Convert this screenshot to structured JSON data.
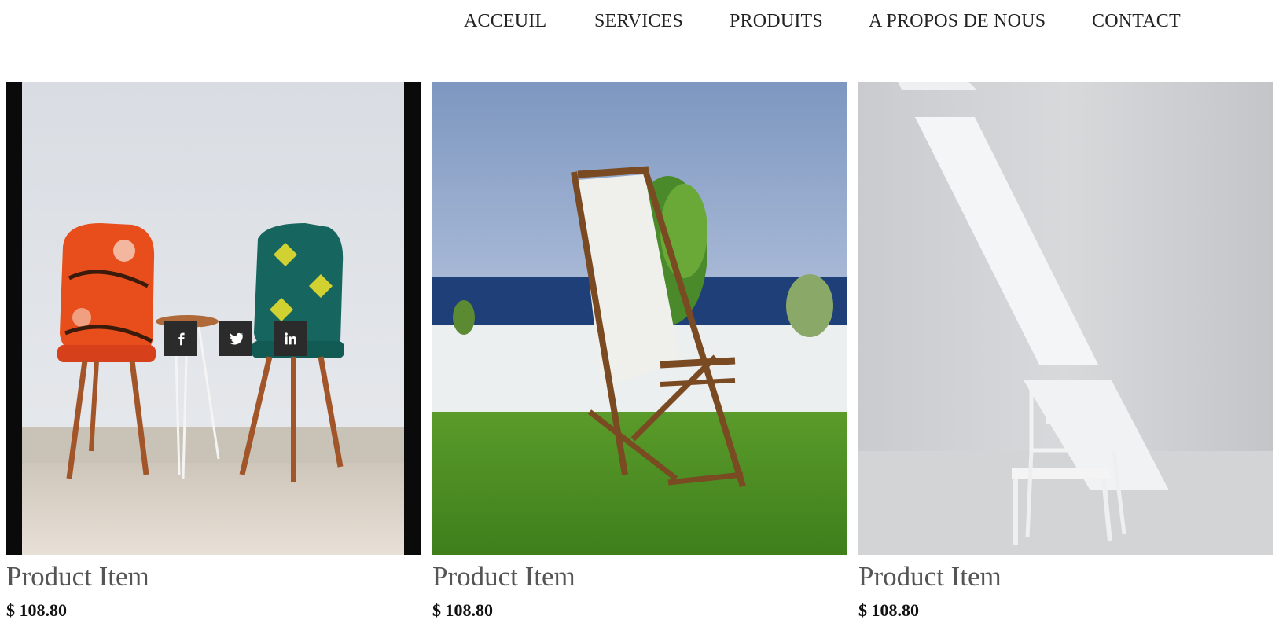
{
  "nav": {
    "items": [
      "ACCEUIL",
      "SERVICES",
      "PRODUITS",
      "A PROPOS DE NOUS",
      "CONTACT"
    ]
  },
  "products": [
    {
      "title": "Product Item",
      "price": "$ 108.80",
      "image": "two-patterned-armchairs-photo"
    },
    {
      "title": "Product Item",
      "price": "$ 108.80",
      "image": "deck-chair-seaside-photo"
    },
    {
      "title": "Product Item",
      "price": "$ 108.80",
      "image": "white-chair-sunlight-photo"
    }
  ],
  "social": {
    "icons": [
      "facebook-icon",
      "twitter-icon",
      "linkedin-icon"
    ]
  },
  "colors": {
    "text": "#222222",
    "title": "#555555",
    "social_bg": "#2b2b2b"
  }
}
